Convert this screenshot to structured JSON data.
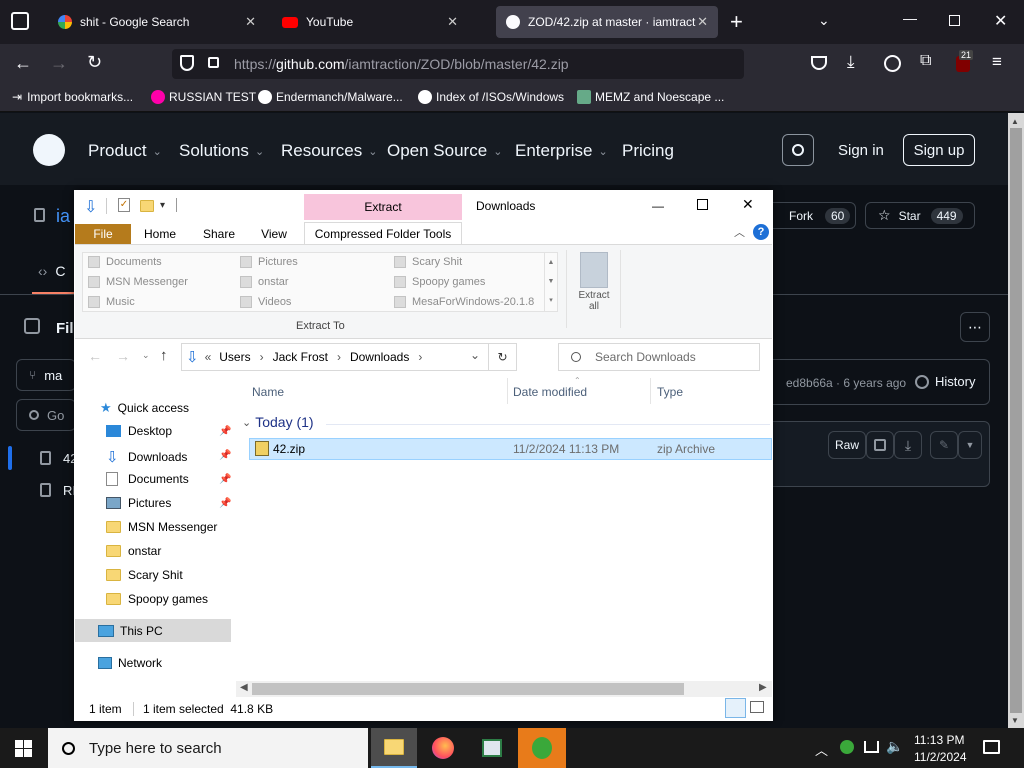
{
  "browser": {
    "tabs": [
      {
        "title": "shit - Google Search",
        "active": false
      },
      {
        "title": "YouTube",
        "active": false
      },
      {
        "title": "ZOD/42.zip at master · iamtract",
        "active": true
      }
    ],
    "url_prefix": "https://",
    "url_host": "github.com",
    "url_path": "/iamtraction/ZOD/blob/master/42.zip",
    "extension_badge": "21",
    "bookmarks": [
      "Import bookmarks...",
      "RUSSIAN TEST",
      "Endermanch/Malware...",
      "Index of /ISOs/Windows",
      "MEMZ and Noescape ..."
    ]
  },
  "github": {
    "nav": [
      "Product",
      "Solutions",
      "Resources",
      "Open Source",
      "Enterprise",
      "Pricing"
    ],
    "sign_in": "Sign in",
    "sign_up": "Sign up",
    "repo_owner_partial": "ia",
    "fork_label": "Fork",
    "fork_count": "60",
    "star_label": "Star",
    "star_count": "449",
    "code_tab_partial": "C",
    "files_partial": "Fil",
    "branch_partial": "ma",
    "goto_partial": "Go",
    "file1_partial": "42",
    "file2_partial": "RI",
    "commit_text": "ed8b66a · 6 years ago",
    "history": "History",
    "raw": "Raw"
  },
  "explorer": {
    "title": "Downloads",
    "context_tab": "Extract",
    "ribbon_tabs": [
      "File",
      "Home",
      "Share",
      "View",
      "Compressed Folder Tools"
    ],
    "extract_targets": [
      [
        "Documents",
        "Pictures",
        "Scary Shit"
      ],
      [
        "MSN Messenger",
        "onstar",
        "Spoopy games"
      ],
      [
        "Music",
        "Videos",
        "MesaForWindows-20.1.8"
      ]
    ],
    "extract_to_label": "Extract To",
    "extract_all_label": "Extract all",
    "breadcrumb": [
      "Users",
      "Jack Frost",
      "Downloads"
    ],
    "search_placeholder": "Search Downloads",
    "columns": [
      "Name",
      "Date modified",
      "Type"
    ],
    "group": "Today (1)",
    "files": [
      {
        "name": "42.zip",
        "date": "11/2/2024 11:13 PM",
        "type": "zip Archive"
      }
    ],
    "quick_access": "Quick access",
    "nav_items": [
      {
        "label": "Desktop",
        "pinned": true
      },
      {
        "label": "Downloads",
        "pinned": true
      },
      {
        "label": "Documents",
        "pinned": true
      },
      {
        "label": "Pictures",
        "pinned": true
      },
      {
        "label": "MSN Messenger",
        "pinned": false
      },
      {
        "label": "onstar",
        "pinned": false
      },
      {
        "label": "Scary Shit",
        "pinned": false
      },
      {
        "label": "Spoopy games",
        "pinned": false
      }
    ],
    "this_pc": "This PC",
    "network": "Network",
    "status_items": "1 item",
    "status_selected": "1 item selected  41.8 KB"
  },
  "taskbar": {
    "search_placeholder": "Type here to search",
    "time": "11:13 PM",
    "date": "11/2/2024"
  },
  "colors": {
    "github_bg": "#0d1117",
    "explorer_file_tab": "#b57b1c",
    "extract_context": "#f8c5dc",
    "selection": "#cce8ff",
    "help_blue": "#1d6fd6"
  }
}
